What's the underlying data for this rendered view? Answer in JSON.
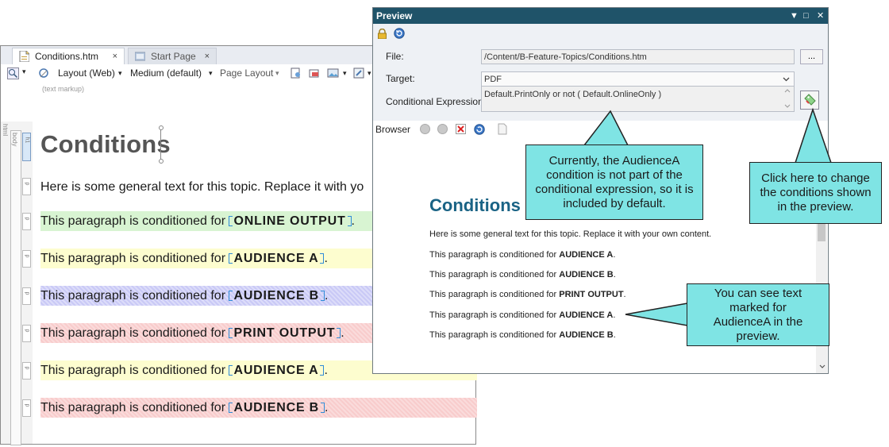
{
  "editor": {
    "tabs": [
      {
        "label": "Conditions.htm",
        "close": "×"
      },
      {
        "label": "Start Page",
        "close": "×"
      }
    ],
    "toolbar": {
      "layout": "Layout (Web)",
      "medium": "Medium (default)",
      "page_layout": "Page Layout",
      "dropdown_arrow": "▾"
    },
    "markup_label": "(text markup)",
    "strip_labels": {
      "html": "html",
      "body": "body",
      "h1": "h1",
      "p": "p"
    },
    "title": "Conditions",
    "intro": "Here is some general text for this topic. Replace it with yo",
    "paragraphs": [
      {
        "prefix": "This paragraph is conditioned for ",
        "condition": "ONLINE OUTPUT",
        "suffix": ".",
        "color": "#d8f4d2"
      },
      {
        "prefix": "This paragraph is conditioned for ",
        "condition": "AUDIENCE A",
        "suffix": ".",
        "color": "#fdfdcf"
      },
      {
        "prefix": "This paragraph is conditioned for ",
        "condition": "AUDIENCE B",
        "suffix": ".",
        "color": "#c9c9f6"
      },
      {
        "prefix": "This paragraph is conditioned for ",
        "condition": "PRINT OUTPUT",
        "suffix": ".",
        "color": "#f8cccc"
      },
      {
        "prefix": "This paragraph is conditioned for ",
        "condition": "AUDIENCE A",
        "suffix": ".",
        "color": "#fdfdcf"
      },
      {
        "prefix": "This paragraph is conditioned for ",
        "condition": "AUDIENCE B",
        "suffix": ".",
        "color": "#f8cccc"
      }
    ]
  },
  "preview": {
    "title": "Preview",
    "controls": {
      "dropdown": "▼",
      "maximize": "□",
      "close": "✕"
    },
    "file_label": "File:",
    "file_value": "/Content/B-Feature-Topics/Conditions.htm",
    "browse_button": "...",
    "target_label": "Target:",
    "target_value": "PDF",
    "cond_label": "Conditional Expression:",
    "cond_value": "Default.PrintOnly or not ( Default.OnlineOnly )",
    "browser_label": "Browser",
    "content": {
      "title": "Conditions",
      "intro": "Here is some general text for this topic. Replace it with your own content.",
      "prefix": "This paragraph is conditioned for ",
      "lines": [
        {
          "cond": "AUDIENCE A",
          "suffix": "."
        },
        {
          "cond": "AUDIENCE B",
          "suffix": "."
        },
        {
          "cond": "PRINT OUTPUT",
          "suffix": "."
        },
        {
          "cond": "AUDIENCE A",
          "suffix": "."
        },
        {
          "cond": "AUDIENCE B",
          "suffix": "."
        }
      ]
    }
  },
  "callouts": {
    "audience": "Currently, the AudienceA condition is not part of the conditional expression, so it is included by default.",
    "change": "Click here to change the conditions shown in the preview.",
    "see_text": "You can see text marked for AudienceA in the preview."
  },
  "colors": {
    "callout": "#7fe4e4",
    "titlebar": "#1f5369",
    "preview_heading": "#1a6385",
    "bracket": "#2e8bd8"
  }
}
